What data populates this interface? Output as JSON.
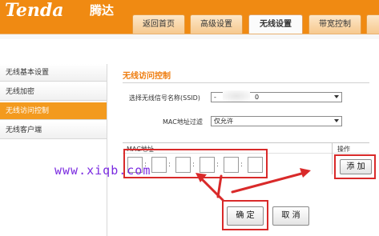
{
  "brand": {
    "logo": "Tenda",
    "name_cn": "腾达"
  },
  "tabs": [
    {
      "label": "返回首页"
    },
    {
      "label": "高级设置"
    },
    {
      "label": "无线设置"
    },
    {
      "label": "带宽控制"
    }
  ],
  "sidebar": {
    "items": [
      {
        "label": "无线基本设置"
      },
      {
        "label": "无线加密"
      },
      {
        "label": "无线访问控制"
      },
      {
        "label": "无线客户端"
      }
    ]
  },
  "main": {
    "title": "无线访问控制",
    "ssid_label": "选择无线信号名称(SSID)",
    "ssid_value_start": "-",
    "ssid_value_end": "0",
    "mac_filter_label": "MAC地址过滤",
    "mac_filter_value": "仅允许",
    "table": {
      "mac_header": "MAC地址",
      "action_header": "操作"
    },
    "add_button": "添 加",
    "ok_button": "确 定",
    "cancel_button": "取 消"
  },
  "watermark": "www.xiqb.com",
  "colors": {
    "brand_orange": "#f08a12",
    "active_sidebar": "#f39a1e",
    "annotation_red": "#d92a2a",
    "watermark": "#7a2ae0"
  }
}
